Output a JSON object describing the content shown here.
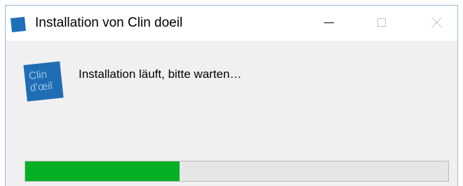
{
  "window": {
    "title": "Installation von Clin doeil",
    "title_icon": "clin-doeil-app-icon",
    "controls": [
      "minimize",
      "maximize",
      "close"
    ]
  },
  "logo": {
    "line1": "Clin",
    "line2": "d'œil",
    "color": "#1f6db3"
  },
  "status": {
    "text": "Installation läuft, bitte warten…"
  },
  "progress": {
    "fraction": 0.365,
    "fill_color": "#06b025",
    "track_color": "#e6e6e6"
  }
}
